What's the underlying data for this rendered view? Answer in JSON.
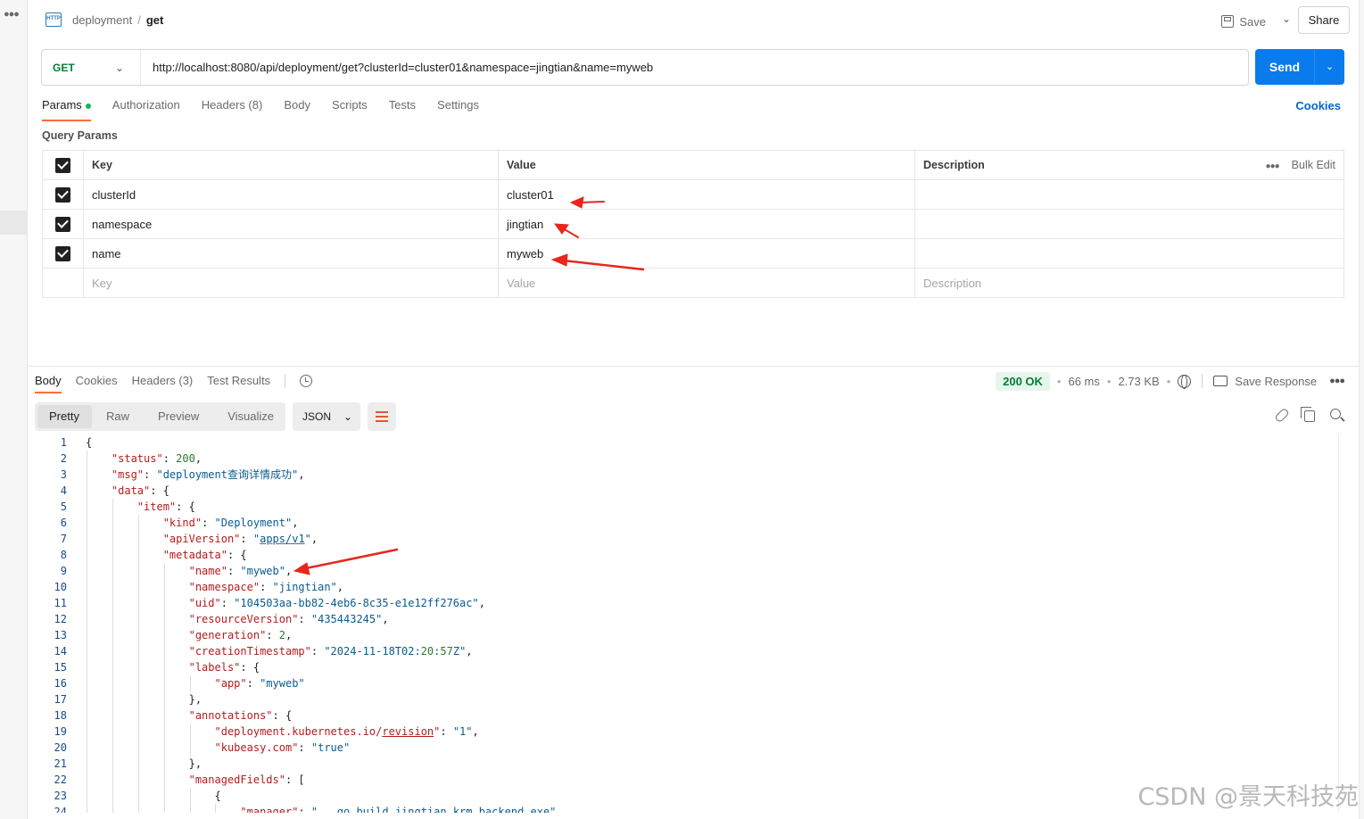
{
  "header": {
    "breadcrumb_parent": "deployment",
    "breadcrumb_sep": "/",
    "breadcrumb_current": "get",
    "save_label": "Save",
    "share_label": "Share"
  },
  "request": {
    "method": "GET",
    "url": "http://localhost:8080/api/deployment/get?clusterId=cluster01&namespace=jingtian&name=myweb",
    "send_label": "Send"
  },
  "request_tabs": [
    "Params",
    "Authorization",
    "Headers (8)",
    "Body",
    "Scripts",
    "Tests",
    "Settings"
  ],
  "cookies_label": "Cookies",
  "query_params": {
    "title": "Query Params",
    "headers": {
      "key": "Key",
      "value": "Value",
      "description": "Description",
      "bulk_edit": "Bulk Edit"
    },
    "rows": [
      {
        "key": "clusterId",
        "value": "cluster01"
      },
      {
        "key": "namespace",
        "value": "jingtian"
      },
      {
        "key": "name",
        "value": "myweb"
      }
    ],
    "placeholder": {
      "key": "Key",
      "value": "Value",
      "description": "Description"
    }
  },
  "response": {
    "tabs": [
      "Body",
      "Cookies",
      "Headers (3)",
      "Test Results"
    ],
    "status": "200 OK",
    "time": "66 ms",
    "size": "2.73 KB",
    "save_response_label": "Save Response",
    "views": [
      "Pretty",
      "Raw",
      "Preview",
      "Visualize"
    ],
    "format": "JSON"
  },
  "code_lines": [
    "{",
    "    \"status\": 200,",
    "    \"msg\": \"deployment查询详情成功\",",
    "    \"data\": {",
    "        \"item\": {",
    "            \"kind\": \"Deployment\",",
    "            \"apiVersion\": \"apps/v1\",",
    "            \"metadata\": {",
    "                \"name\": \"myweb\",",
    "                \"namespace\": \"jingtian\",",
    "                \"uid\": \"104503aa-bb82-4eb6-8c35-e1e12ff276ac\",",
    "                \"resourceVersion\": \"435443245\",",
    "                \"generation\": 2,",
    "                \"creationTimestamp\": \"2024-11-18T02:20:57Z\",",
    "                \"labels\": {",
    "                    \"app\": \"myweb\"",
    "                },",
    "                \"annotations\": {",
    "                    \"deployment.kubernetes.io/revision\": \"1\",",
    "                    \"kubeasy.com\": \"true\"",
    "                },",
    "                \"managedFields\": [",
    "                    {",
    "                        \"manager\": \"___go_build_jingtian_krm_backend.exe\","
  ],
  "watermark": "CSDN @景天科技苑",
  "colors": {
    "accent_orange": "#ff6c37",
    "send_blue": "#097bed",
    "method_green": "#007f31",
    "annotation_red": "#e8261b"
  }
}
